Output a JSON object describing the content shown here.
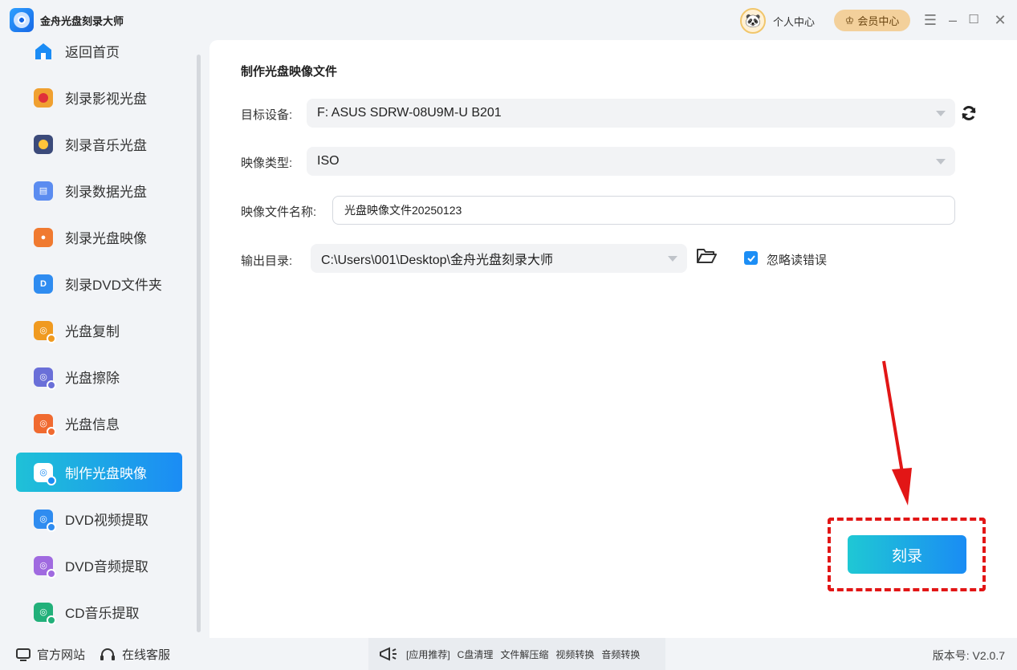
{
  "app": {
    "title": "金舟光盘刻录大师"
  },
  "header": {
    "personal_center": "个人中心",
    "member_center": "会员中心"
  },
  "sidebar": {
    "items": [
      {
        "label": "返回首页",
        "icon": "home-icon",
        "color": "#1b8cf5"
      },
      {
        "label": "刻录影视光盘",
        "icon": "video-disc-icon",
        "color": "#f0a030"
      },
      {
        "label": "刻录音乐光盘",
        "icon": "music-disc-icon",
        "color": "#3b4a7a"
      },
      {
        "label": "刻录数据光盘",
        "icon": "data-disc-icon",
        "color": "#5b8cf0"
      },
      {
        "label": "刻录光盘映像",
        "icon": "disc-image-icon",
        "color": "#f07a30"
      },
      {
        "label": "刻录DVD文件夹",
        "icon": "dvd-folder-icon",
        "color": "#2f8cf0"
      },
      {
        "label": "光盘复制",
        "icon": "disc-copy-icon",
        "color": "#f09a20"
      },
      {
        "label": "光盘擦除",
        "icon": "disc-erase-icon",
        "color": "#6a6fd8"
      },
      {
        "label": "光盘信息",
        "icon": "disc-info-icon",
        "color": "#f06a30"
      },
      {
        "label": "制作光盘映像",
        "icon": "make-image-icon",
        "color": "#ffffff",
        "active": true
      },
      {
        "label": "DVD视频提取",
        "icon": "dvd-video-extract-icon",
        "color": "#2f8cf0"
      },
      {
        "label": "DVD音频提取",
        "icon": "dvd-audio-extract-icon",
        "color": "#a06ae0"
      },
      {
        "label": "CD音乐提取",
        "icon": "cd-music-extract-icon",
        "color": "#22b07a"
      }
    ]
  },
  "main": {
    "section_title": "制作光盘映像文件",
    "target_device_label": "目标设备:",
    "target_device_value": "F: ASUS SDRW-08U9M-U B201",
    "image_type_label": "映像类型:",
    "image_type_value": "ISO",
    "file_name_label": "映像文件名称:",
    "file_name_value": "光盘映像文件20250123",
    "output_dir_label": "输出目录:",
    "output_dir_value": "C:\\Users\\001\\Desktop\\金舟光盘刻录大师",
    "ignore_errors_label": "忽略读错误",
    "ignore_errors_checked": true,
    "burn_button": "刻录"
  },
  "footer": {
    "official_site": "官方网站",
    "online_service": "在线客服",
    "promo_items": [
      "[应用推荐]",
      "C盘清理",
      "文件解压缩",
      "视频转换",
      "音频转换"
    ],
    "version": "版本号: V2.0.7"
  },
  "colors": {
    "accent": "#1b8cf5",
    "highlight": "#e21616",
    "member": "#f3d09b"
  }
}
